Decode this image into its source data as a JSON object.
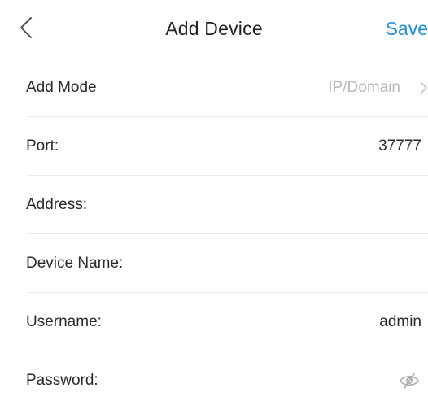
{
  "header": {
    "back_icon": "chevron-left-icon",
    "title": "Add Device",
    "save_label": "Save"
  },
  "form": {
    "add_mode": {
      "label": "Add Mode",
      "value": "IP/Domain",
      "icon": "chevron-right-icon"
    },
    "port": {
      "label": "Port:",
      "value": "37777"
    },
    "address": {
      "label": "Address:",
      "value": ""
    },
    "device_name": {
      "label": "Device Name:",
      "value": ""
    },
    "username": {
      "label": "Username:",
      "value": "admin"
    },
    "password": {
      "label": "Password:",
      "value": "",
      "icon": "eye-off-icon"
    }
  },
  "colors": {
    "accent": "#1e8fe6",
    "text": "#2a2a2a",
    "muted": "#b8b8b8",
    "divider": "#ebebeb"
  }
}
